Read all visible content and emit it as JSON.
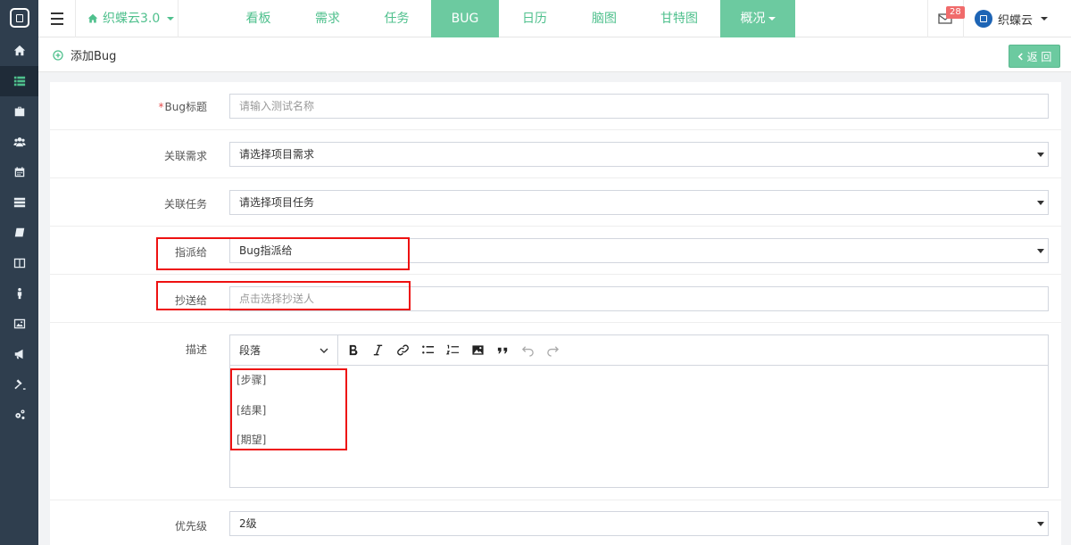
{
  "app": {
    "name": "织蝶云"
  },
  "topbar": {
    "project": "织蝶云3.0",
    "nav": [
      {
        "label": "看板",
        "width": 77,
        "highlight": false
      },
      {
        "label": "需求",
        "width": 78,
        "highlight": false
      },
      {
        "label": "任务",
        "width": 77,
        "highlight": false
      },
      {
        "label": "BUG",
        "width": 76,
        "highlight": true
      },
      {
        "label": "日历",
        "width": 80,
        "highlight": false
      },
      {
        "label": "脑图",
        "width": 76,
        "highlight": false
      },
      {
        "label": "甘特图",
        "width": 92,
        "highlight": false
      },
      {
        "label": "概况",
        "width": 84,
        "highlight": true,
        "dropdown": true
      }
    ],
    "mail_badge": "28",
    "user_name": "织蝶云"
  },
  "page": {
    "title": "添加Bug",
    "back_label": "返 回"
  },
  "form": {
    "title_label": "Bug标题",
    "title_required": "*",
    "title_placeholder": "请输入测试名称",
    "req_label": "关联需求",
    "req_value": "请选择项目需求",
    "task_label": "关联任务",
    "task_value": "请选择项目任务",
    "assign_label": "指派给",
    "assign_value": "Bug指派给",
    "cc_label": "抄送给",
    "cc_placeholder": "点击选择抄送人",
    "desc_label": "描述",
    "heading_value": "段落",
    "desc_lines": [
      "[步骤]",
      "[结果]",
      "[期望]"
    ],
    "priority_label": "优先级",
    "priority_value": "2级"
  },
  "colors": {
    "accent": "#4fc08d",
    "nav_highlight": "#6ccaa0",
    "sidebar": "#2f3e4e",
    "badge": "#f06b6b",
    "annotation": "#e11111"
  }
}
